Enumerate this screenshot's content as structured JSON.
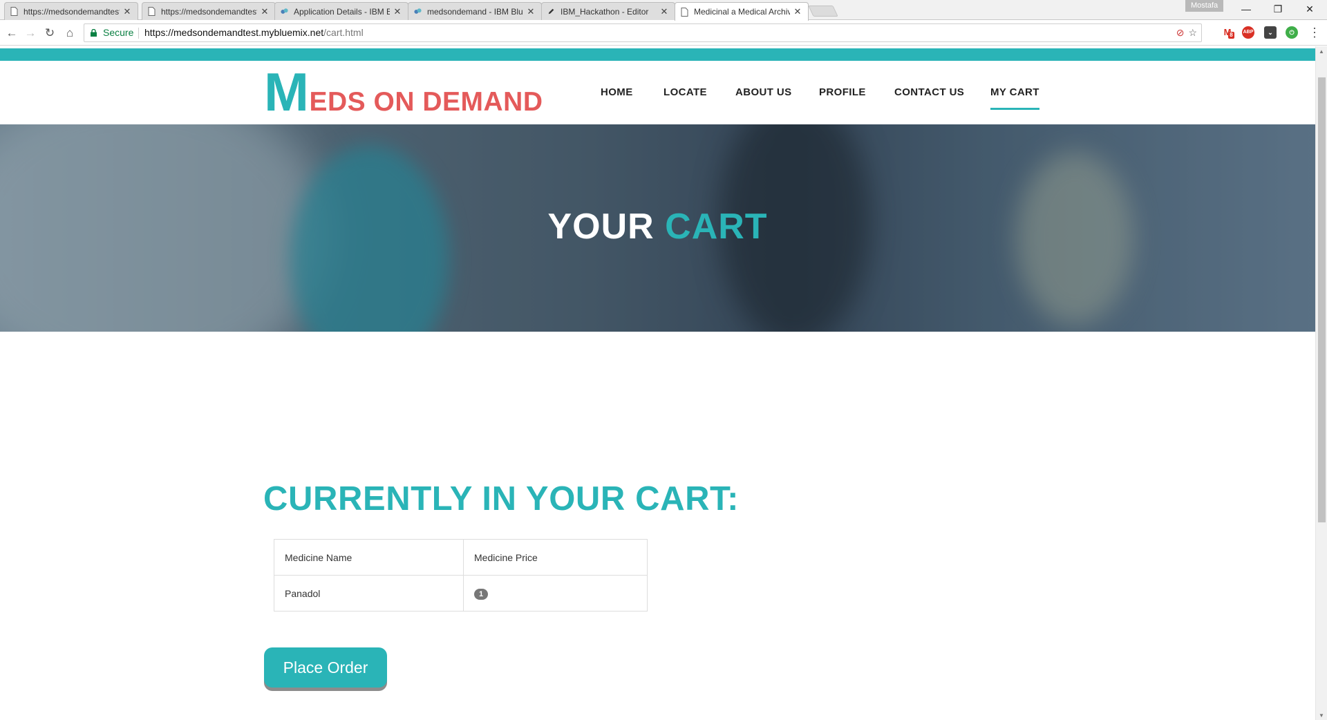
{
  "browser": {
    "tabs": [
      {
        "title": "https://medsondemandtest",
        "icon": "page-icon"
      },
      {
        "title": "https://medsondemandtest",
        "icon": "page-icon"
      },
      {
        "title": "Application Details - IBM Bluemix",
        "icon": "bluemix-icon"
      },
      {
        "title": "medsondemand - IBM Bluemix",
        "icon": "bluemix-icon"
      },
      {
        "title": "IBM_Hackathon - Editor",
        "icon": "pencil-icon"
      },
      {
        "title": "Medicinal a Medical Archive",
        "icon": "page-icon"
      }
    ],
    "profile_name": "Mostafa",
    "window_buttons": {
      "minimize": "—",
      "restore": "❐",
      "close": "✕"
    },
    "secure_label": "Secure",
    "url_base": "https://medsondemandtest.mybluemix.net",
    "url_path": "/cart.html",
    "extension_badge": "8",
    "extension_abp": "ABP"
  },
  "site": {
    "logo_initial": "M",
    "logo_rest": "EDS ON DEMAND",
    "nav": [
      {
        "label": "HOME"
      },
      {
        "label": "LOCATE"
      },
      {
        "label": "ABOUT US"
      },
      {
        "label": "PROFILE"
      },
      {
        "label": "CONTACT US"
      },
      {
        "label": "MY CART",
        "active": true
      }
    ],
    "hero_title_plain": "YOUR",
    "hero_title_accent": "CART",
    "cart_heading": "CURRENTLY IN YOUR CART:",
    "table": {
      "headers": [
        "Medicine Name",
        "Medicine Price"
      ],
      "rows": [
        {
          "name": "Panadol",
          "price": "1"
        }
      ]
    },
    "place_order_label": "Place Order"
  },
  "colors": {
    "accent": "#2ab4b7",
    "logo_red": "#e45a5a"
  }
}
